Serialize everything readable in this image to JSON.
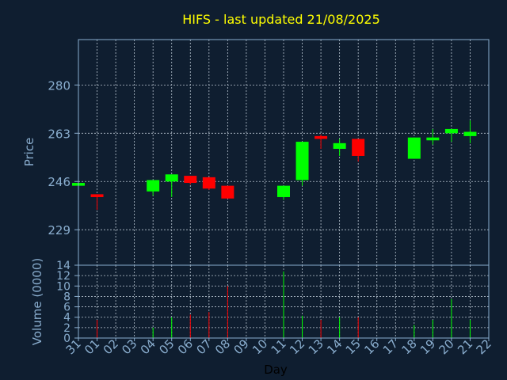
{
  "chart_data": {
    "type": "candlestick",
    "title": "HIFS - last updated 21/08/2025",
    "xlabel": "Day",
    "price_ylabel": "Price",
    "volume_ylabel": "Volume (0000)",
    "price_yticks": [
      229,
      246,
      263,
      280
    ],
    "price_ylim": [
      216.5,
      296
    ],
    "volume_yticks": [
      0,
      2,
      4,
      6,
      8,
      10,
      12,
      14
    ],
    "volume_ylim": [
      0,
      14
    ],
    "x_ticks": [
      "31",
      "01",
      "02",
      "03",
      "04",
      "05",
      "06",
      "07",
      "08",
      "09",
      "10",
      "11",
      "12",
      "13",
      "14",
      "15",
      "16",
      "17",
      "18",
      "19",
      "20",
      "21",
      "22"
    ],
    "candles": [
      {
        "day": "31",
        "open": 244.5,
        "close": 245.5,
        "high": 245.5,
        "low": 244.5,
        "volume": 0
      },
      {
        "day": "01",
        "open": 241.5,
        "close": 240.5,
        "high": 241.5,
        "low": 236.0,
        "volume": 3.5
      },
      {
        "day": "04",
        "open": 242.5,
        "close": 246.5,
        "high": 246.5,
        "low": 241.0,
        "volume": 2.0
      },
      {
        "day": "05",
        "open": 246.0,
        "close": 248.5,
        "high": 248.5,
        "low": 240.5,
        "volume": 4.0
      },
      {
        "day": "06",
        "open": 248.0,
        "close": 245.5,
        "high": 248.0,
        "low": 245.0,
        "volume": 4.5
      },
      {
        "day": "07",
        "open": 247.5,
        "close": 243.5,
        "high": 247.5,
        "low": 243.0,
        "volume": 5.0
      },
      {
        "day": "08",
        "open": 244.5,
        "close": 240.0,
        "high": 244.5,
        "low": 240.0,
        "volume": 10.0
      },
      {
        "day": "11",
        "open": 240.5,
        "close": 244.5,
        "high": 244.5,
        "low": 239.5,
        "volume": 12.8
      },
      {
        "day": "12",
        "open": 246.5,
        "close": 260.0,
        "high": 260.0,
        "low": 244.5,
        "volume": 4.3
      },
      {
        "day": "13",
        "open": 262.0,
        "close": 261.0,
        "high": 262.5,
        "low": 257.5,
        "volume": 3.5
      },
      {
        "day": "14",
        "open": 257.5,
        "close": 259.5,
        "high": 261.0,
        "low": 255.0,
        "volume": 4.0
      },
      {
        "day": "15",
        "open": 261.0,
        "close": 255.0,
        "high": 261.0,
        "low": 253.0,
        "volume": 4.0
      },
      {
        "day": "18",
        "open": 254.0,
        "close": 261.5,
        "high": 261.5,
        "low": 254.0,
        "volume": 2.5
      },
      {
        "day": "19",
        "open": 260.5,
        "close": 261.5,
        "high": 264.5,
        "low": 259.0,
        "volume": 3.5
      },
      {
        "day": "20",
        "open": 263.0,
        "close": 264.5,
        "high": 264.5,
        "low": 260.0,
        "volume": 7.5
      },
      {
        "day": "21",
        "open": 262.0,
        "close": 263.5,
        "high": 267.5,
        "low": 259.5,
        "volume": 3.5
      }
    ],
    "colors": {
      "background": "#0f1e30",
      "up": "#00ff00",
      "down": "#ff0000",
      "title": "#ffff00",
      "axis_text": "#8aaecf",
      "grid": "#b8c4d0",
      "frame": "#8aaecf",
      "xlabel": "#000000"
    },
    "grid": true
  }
}
